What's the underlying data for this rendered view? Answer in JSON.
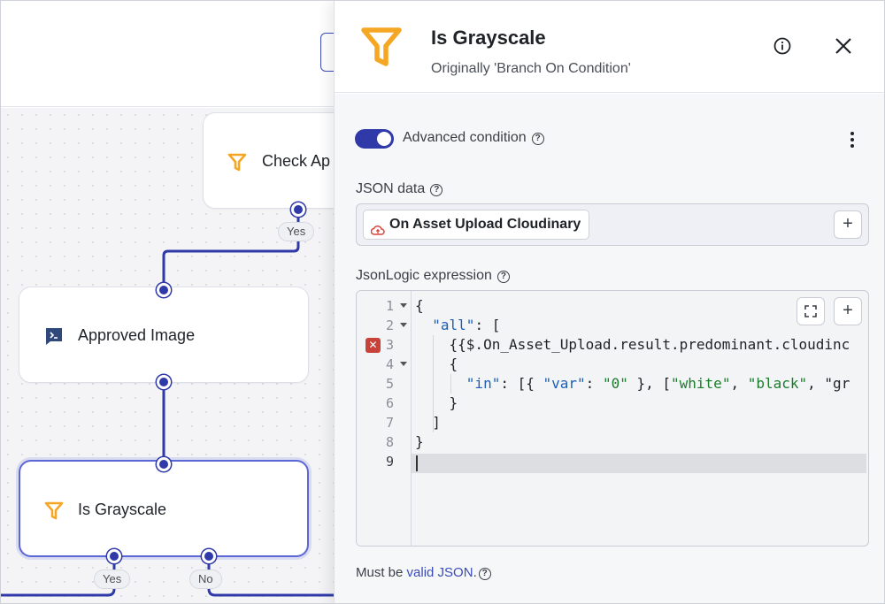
{
  "canvas": {
    "nodes": [
      {
        "label": "Check Ap",
        "icon": "filter-icon"
      },
      {
        "label": "Approved Image",
        "icon": "terminal-icon"
      },
      {
        "label": "Is Grayscale",
        "icon": "filter-icon"
      }
    ],
    "pills": {
      "check_yes": "Yes",
      "grayscale_yes": "Yes",
      "grayscale_no": "No"
    }
  },
  "panel": {
    "title": "Is Grayscale",
    "subtitle": "Originally 'Branch On Condition'",
    "advanced_condition_label": "Advanced condition",
    "advanced_condition_enabled": true,
    "json_data_label": "JSON data",
    "json_data_chip": "On Asset Upload Cloudinary",
    "jsonlogic_label": "JsonLogic expression",
    "code_lines": [
      {
        "num": "1",
        "text": "{"
      },
      {
        "num": "2",
        "text": "  \"all\": ["
      },
      {
        "num": "3",
        "text": "    {{$.On_Asset_Upload.result.predominant.cloudinc"
      },
      {
        "num": "4",
        "text": "    {"
      },
      {
        "num": "5",
        "text": "      \"in\": [{ \"var\": \"0\" }, [\"white\", \"black\", \"gr"
      },
      {
        "num": "6",
        "text": "    }"
      },
      {
        "num": "7",
        "text": "  ]"
      },
      {
        "num": "8",
        "text": "}"
      },
      {
        "num": "9",
        "text": ""
      }
    ],
    "footer_prefix": "Must be ",
    "footer_link": "valid JSON",
    "footer_suffix": "."
  },
  "colors": {
    "accent": "#2f3aa8",
    "filter_icon": "#f5a623",
    "error": "#c8423a"
  }
}
